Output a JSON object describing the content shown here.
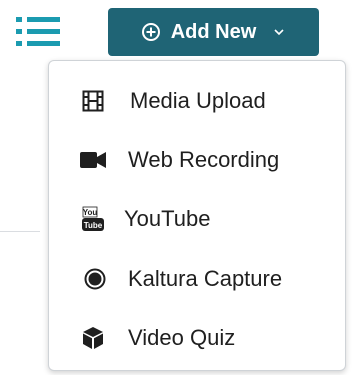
{
  "colors": {
    "accent": "#1f6475",
    "list_icon": "#1b9bb0",
    "menu_text": "#1f1f1f"
  },
  "header": {
    "list_toggle_icon": "list-icon",
    "add_new": {
      "label": "Add New",
      "icon": "plus-circle-icon",
      "dropdown_icon": "chevron-down-icon"
    }
  },
  "menu": {
    "items": [
      {
        "label": "Media Upload",
        "icon": "film-icon"
      },
      {
        "label": "Web Recording",
        "icon": "video-camera-icon"
      },
      {
        "label": "YouTube",
        "icon": "youtube-icon"
      },
      {
        "label": "Kaltura Capture",
        "icon": "record-icon"
      },
      {
        "label": "Video Quiz",
        "icon": "cube-icon"
      }
    ]
  }
}
